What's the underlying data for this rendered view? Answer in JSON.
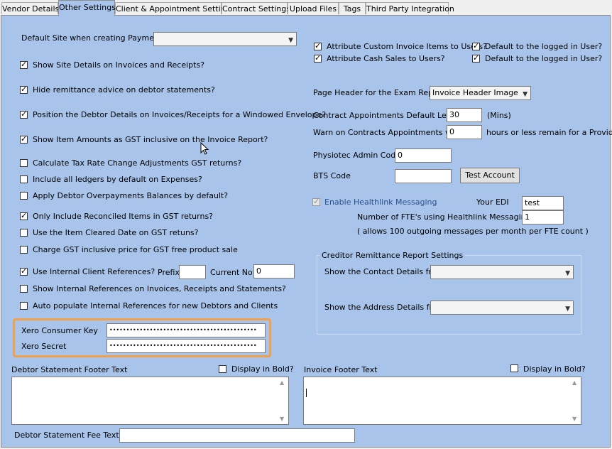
{
  "tabs": [
    "Vendor Details",
    "Other Settings",
    "Client & Appointment Settings",
    "Contract Settings",
    "Upload Files",
    "Tags",
    "Third Party Integration"
  ],
  "left": {
    "default_site_label": "Default Site when creating Payments",
    "default_site_value": "",
    "checks": [
      {
        "label": "Show Site Details on Invoices and Receipts?",
        "checked": true
      },
      {
        "label": "Hide remittance advice on debtor statements?",
        "checked": true
      },
      {
        "label": "Position the Debtor Details on Invoices/Receipts for a Windowed Envelope?",
        "checked": true
      },
      {
        "label": "Show Item Amounts as GST inclusive on the Invoice Report?",
        "checked": true
      },
      {
        "label": "Calculate Tax Rate Change Adjustments GST returns?",
        "checked": false
      },
      {
        "label": "Include all ledgers by default on Expenses?",
        "checked": false
      },
      {
        "label": "Apply Debtor Overpayments Balances by default?",
        "checked": false
      },
      {
        "label": "Only Include Reconciled Items in GST returns?",
        "checked": true
      },
      {
        "label": "Use the Item Cleared Date on GST retuns?",
        "checked": false
      },
      {
        "label": "Charge GST inclusive price for GST free product sale",
        "checked": false
      },
      {
        "label": "Use Internal Client References?",
        "checked": true
      },
      {
        "label": "Show Internal References on Invoices, Receipts and Statements?",
        "checked": false
      },
      {
        "label": "Auto populate Internal References for new Debtors and Clients",
        "checked": false
      }
    ],
    "prefix_label": "Prefix",
    "prefix_value": "",
    "current_no_label": "Current No",
    "current_no_value": "0",
    "xero_key_label": "Xero Consumer Key",
    "xero_key_value": "••••••••••••••••••••••••••••••••••••••••••••",
    "xero_secret_label": "Xero Secret",
    "xero_secret_value": "••••••••••••••••••••••••••••••••••••••••••••",
    "debtor_footer_label": "Debtor Statement Footer Text",
    "debtor_bold_label": "Display in Bold?",
    "debtor_fee_label": "Debtor Statement Fee Text",
    "debtor_fee_value": ""
  },
  "right": {
    "attr_custom_label": "Attribute Custom Invoice Items to Users?",
    "attr_cash_label": "Attribute Cash Sales to Users?",
    "default_user_label_1": "Default to the logged in User?",
    "default_user_label_2": "Default to the logged in User?",
    "page_header_label": "Page Header for the Exam Report",
    "page_header_value": "Invoice Header Image",
    "contract_len_label": "Contract Appointments Default Length",
    "contract_len_value": "30",
    "contract_len_unit": "(Mins)",
    "warn_label": "Warn on Contracts Appointments when",
    "warn_value": "0",
    "warn_suffix": "hours or less remain for a Provider",
    "physiotec_label": "Physiotec Admin Code",
    "physiotec_value": "0",
    "bts_label": "BTS Code",
    "bts_value": "",
    "test_account_label": "Test Account",
    "healthlink_label": "Enable Healthlink Messaging",
    "your_edi_label": "Your EDI",
    "your_edi_value": "test",
    "fte_label": "Number of FTE's using Healthlink Messaging",
    "fte_value": "1",
    "fte_note": "( allows 100 outgoing messages per month per FTE count )",
    "creditor_group_title": "Creditor Remittance Report Settings",
    "contact_details_label": "Show the Contact Details from",
    "contact_details_value": "",
    "address_details_label": "Show the Address Details from",
    "address_details_value": "",
    "invoice_footer_label": "Invoice Footer Text",
    "invoice_bold_label": "Display in Bold?"
  },
  "colors": {
    "panel_bg": "#a9c4ea",
    "highlight": "#f2a14a"
  }
}
